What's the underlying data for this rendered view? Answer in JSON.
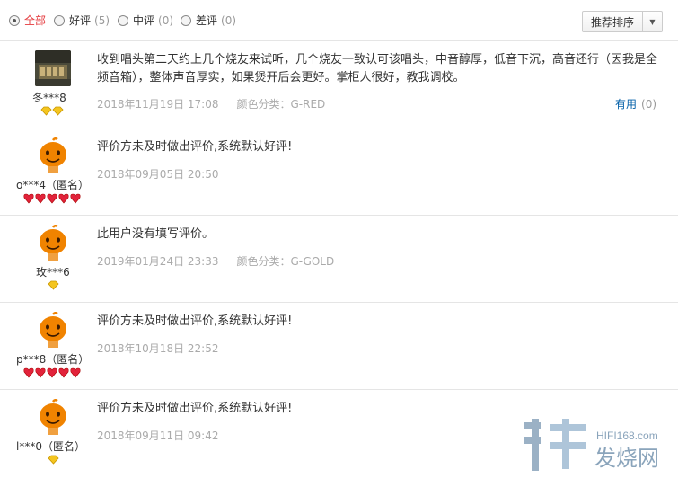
{
  "filters": [
    {
      "label": "全部",
      "count": "",
      "checked": true
    },
    {
      "label": "好评",
      "count": "(5)",
      "checked": false
    },
    {
      "label": "中评",
      "count": "(0)",
      "checked": false
    },
    {
      "label": "差评",
      "count": "(0)",
      "checked": false
    }
  ],
  "sort": {
    "label": "推荐排序",
    "arrow": "▼"
  },
  "reviews": [
    {
      "user": "冬***8",
      "avatar": "product-photo-avatar",
      "level_icon": "gold-diamond-icon",
      "level_count": 2,
      "text": "收到唱头第二天约上几个烧友来试听，几个烧友一致认可该唱头，中音醇厚，低音下沉，高音还行（因我是全频音箱），整体声音厚实，如果煲开后会更好。掌柜人很好，教我调校。",
      "date": "2018年11月19日 17:08",
      "color": "颜色分类：G-RED",
      "useful_label": "有用",
      "useful_count": "(0)"
    },
    {
      "user": "o***4（匿名）",
      "avatar": "orange-mascot-avatar",
      "level_icon": "red-heart-icon",
      "level_count": 5,
      "text": "评价方未及时做出评价,系统默认好评!",
      "date": "2018年09月05日 20:50",
      "color": ""
    },
    {
      "user": "玫***6",
      "avatar": "orange-mascot-avatar",
      "level_icon": "gold-diamond-icon",
      "level_count": 1,
      "text": "此用户没有填写评价。",
      "date": "2019年01月24日 23:33",
      "color": "颜色分类：G-GOLD"
    },
    {
      "user": "p***8（匿名）",
      "avatar": "orange-mascot-avatar",
      "level_icon": "red-heart-icon",
      "level_count": 5,
      "text": "评价方未及时做出评价,系统默认好评!",
      "date": "2018年10月18日 22:52",
      "color": ""
    },
    {
      "user": "l***0（匿名）",
      "avatar": "orange-mascot-avatar",
      "level_icon": "gold-diamond-icon",
      "level_count": 1,
      "text": "评价方未及时做出评价,系统默认好评!",
      "date": "2018年09月11日 09:42",
      "color": ""
    }
  ],
  "watermark": {
    "site": "HIFI168.com",
    "name": "发烧网",
    "logo": "fashao-logo"
  },
  "colors": {
    "accent": "#e4393c",
    "link": "#005ea7",
    "muted": "#aaaaaa",
    "mascot": "#f08300"
  }
}
